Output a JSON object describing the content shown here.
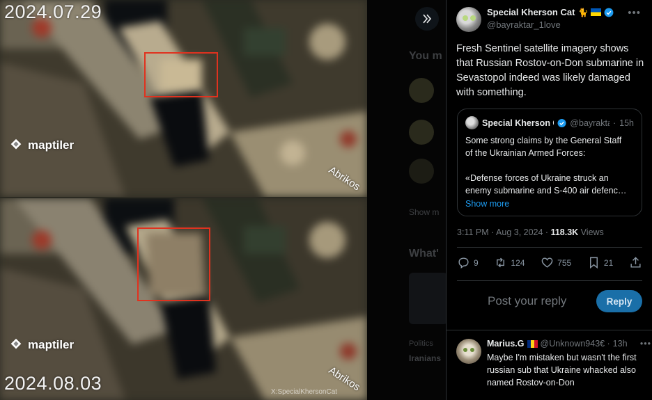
{
  "image": {
    "date_top": "2024.07.29",
    "date_bottom": "2024.08.03",
    "map_brand": "maptiler",
    "place_label": "Abrikos",
    "watermark": "X:SpecialKhersonCat"
  },
  "background": {
    "heading_you": "You m",
    "heading_whats": "What'",
    "show_more": "Show m",
    "trend_title": "Iranians",
    "trend_sub": "Politics"
  },
  "tweet": {
    "author_name": "Special Kherson Cat",
    "author_emoji": "🐈",
    "author_handle": "@bayraktar_1love",
    "text": "Fresh Sentinel satellite imagery shows that Russian Rostov-on-Don submarine in Sevastopol indeed was likely damaged with something.",
    "quote": {
      "name": "Special Kherson C",
      "handle": "@bayrakta",
      "time": "15h",
      "line1": "Some strong claims by the General Staff",
      "line2": "of the Ukrainian Armed Forces:",
      "line3": "«Defense forces of Ukraine struck an",
      "line4": "enemy submarine and S-400 air defenc…",
      "show_more": "Show more"
    },
    "time": "3:11 PM · Aug 3, 2024 · ",
    "views_count": "118.3K",
    "views_label": " Views",
    "replies": "9",
    "reposts": "124",
    "likes": "755",
    "bookmarks": "21"
  },
  "reply_box": {
    "placeholder": "Post your reply",
    "button": "Reply"
  },
  "reply": {
    "name": "Marius.G",
    "handle": "@Unknown943€",
    "time": "13h",
    "text": "Maybe I'm mistaken but wasn't the first russian sub that Ukraine whacked also named Rostov-on-Don"
  },
  "colors": {
    "accent": "#1d9bf0",
    "reply_button": "#1a6fa8",
    "highlight_box": "#e0321f",
    "muted_text": "#71767b"
  }
}
